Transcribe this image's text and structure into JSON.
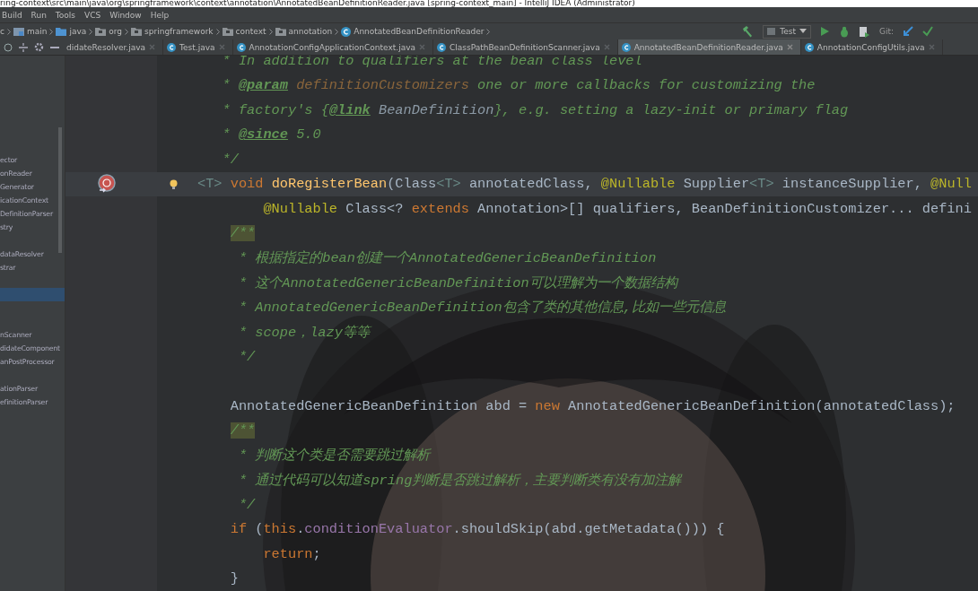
{
  "window": {
    "title": "ring-context\\src\\main\\java\\org\\springframework\\context\\annotation\\AnnotatedBeanDefinitionReader.java [spring-context_main] - IntelliJ IDEA (Administrator)"
  },
  "menu": [
    "Build",
    "Run",
    "Tools",
    "VCS",
    "Window",
    "Help"
  ],
  "breadcrumbs": [
    {
      "label": "c",
      "kind": "text"
    },
    {
      "label": "main",
      "kind": "module"
    },
    {
      "label": "java",
      "kind": "source"
    },
    {
      "label": "org",
      "kind": "folder"
    },
    {
      "label": "springframework",
      "kind": "folder"
    },
    {
      "label": "context",
      "kind": "folder"
    },
    {
      "label": "annotation",
      "kind": "folder"
    },
    {
      "label": "AnnotatedBeanDefinitionReader",
      "kind": "class"
    }
  ],
  "toolbar": {
    "run_config": "Test",
    "vcs_label": "Git:"
  },
  "tabs": [
    {
      "label": "didateResolver.java",
      "selected": false,
      "icon": false
    },
    {
      "label": "Test.java",
      "selected": false,
      "icon": true
    },
    {
      "label": "AnnotationConfigApplicationContext.java",
      "selected": false,
      "icon": true
    },
    {
      "label": "ClassPathBeanDefinitionScanner.java",
      "selected": false,
      "icon": true
    },
    {
      "label": "AnnotatedBeanDefinitionReader.java",
      "selected": true,
      "icon": true
    },
    {
      "label": "AnnotationConfigUtils.java",
      "selected": false,
      "icon": true
    }
  ],
  "sidebar": {
    "items": [
      {
        "kind": "gap"
      },
      {
        "kind": "gap"
      },
      {
        "kind": "gap"
      },
      {
        "kind": "gap"
      },
      {
        "kind": "gap"
      },
      {
        "kind": "gap"
      },
      {
        "kind": "gap"
      },
      {
        "kind": "item",
        "label": "ector",
        "selected": false
      },
      {
        "kind": "item",
        "label": "onReader",
        "selected": false
      },
      {
        "kind": "item",
        "label": "Generator",
        "selected": false
      },
      {
        "kind": "item",
        "label": "icationContext",
        "selected": false
      },
      {
        "kind": "item",
        "label": "DefinitionParser",
        "selected": false
      },
      {
        "kind": "item",
        "label": "stry",
        "selected": false
      },
      {
        "kind": "gap"
      },
      {
        "kind": "item",
        "label": "dataResolver",
        "selected": false
      },
      {
        "kind": "item",
        "label": "strar",
        "selected": false
      },
      {
        "kind": "gap"
      },
      {
        "kind": "item",
        "selected": true
      },
      {
        "kind": "gap"
      },
      {
        "kind": "gap"
      },
      {
        "kind": "item",
        "label": "nScanner",
        "selected": false
      },
      {
        "kind": "item",
        "label": "didateComponent",
        "selected": false
      },
      {
        "kind": "item",
        "label": "anPostProcessor",
        "selected": false
      },
      {
        "kind": "gap"
      },
      {
        "kind": "item",
        "label": "ationParser",
        "selected": false
      },
      {
        "kind": "item",
        "label": "efinitionParser",
        "selected": false
      }
    ]
  },
  "editor": {
    "lines": [
      {
        "kind": "doc",
        "tokens": [
          {
            "kind": "doc",
            "text": "* In addition to qualifiers at the bean class level"
          }
        ]
      },
      {
        "kind": "doc",
        "tokens": [
          {
            "kind": "doc",
            "text": "* "
          },
          {
            "kind": "doc-tag",
            "text": "@param"
          },
          {
            "kind": "doc-param",
            "text": " definitionCustomizers"
          },
          {
            "kind": "doc",
            "text": " one or more callbacks for customizing the"
          }
        ]
      },
      {
        "kind": "doc",
        "tokens": [
          {
            "kind": "doc",
            "text": "* factory's {"
          },
          {
            "kind": "doc-tag",
            "text": "@link"
          },
          {
            "kind": "doc-link",
            "text": " BeanDefinition"
          },
          {
            "kind": "doc",
            "text": "}, e.g. setting a lazy-init or primary flag"
          }
        ]
      },
      {
        "kind": "doc",
        "tokens": [
          {
            "kind": "doc",
            "text": "* "
          },
          {
            "kind": "doc-tag",
            "text": "@since"
          },
          {
            "kind": "doc",
            "text": " 5.0"
          }
        ]
      },
      {
        "kind": "doc",
        "tokens": [
          {
            "kind": "doc",
            "text": "*/"
          }
        ]
      },
      {
        "kind": "signature",
        "current": true,
        "marker": true,
        "bulb": true,
        "tokens": [
          {
            "kind": "type-param",
            "text": "<T>"
          },
          {
            "kind": "keyword",
            "text": " void "
          },
          {
            "kind": "method",
            "text": "doRegisterBean"
          },
          {
            "kind": "text",
            "text": "(Class"
          },
          {
            "kind": "type-param",
            "text": "<T>"
          },
          {
            "kind": "text",
            "text": " annotatedClass, "
          },
          {
            "kind": "annotation",
            "text": "@Nullable"
          },
          {
            "kind": "text",
            "text": " Supplier"
          },
          {
            "kind": "type-param",
            "text": "<T>"
          },
          {
            "kind": "text",
            "text": " instanceSupplier, "
          },
          {
            "kind": "annotation",
            "text": "@Null"
          }
        ]
      },
      {
        "kind": "continuation",
        "tokens": [
          {
            "kind": "annotation",
            "text": "@Nullable"
          },
          {
            "kind": "text",
            "text": " Class<? "
          },
          {
            "kind": "keyword",
            "text": "extends"
          },
          {
            "kind": "text",
            "text": " Annotation>[] qualifiers, BeanDefinitionCustomizer... defini"
          }
        ]
      },
      {
        "kind": "body",
        "tokens": [
          {
            "kind": "doc-fold",
            "text": "/**"
          }
        ]
      },
      {
        "kind": "body-doc",
        "tokens": [
          {
            "kind": "doc",
            "text": "* 根据指定的bean创建一个AnnotatedGenericBeanDefinition"
          }
        ]
      },
      {
        "kind": "body-doc",
        "tokens": [
          {
            "kind": "doc",
            "text": "* 这个AnnotatedGenericBeanDefinition可以理解为一个数据结构"
          }
        ]
      },
      {
        "kind": "body-doc",
        "tokens": [
          {
            "kind": "doc",
            "text": "* AnnotatedGenericBeanDefinition包含了类的其他信息,比如一些元信息"
          }
        ]
      },
      {
        "kind": "body-doc",
        "tokens": [
          {
            "kind": "doc",
            "text": "* scope，lazy等等"
          }
        ]
      },
      {
        "kind": "body-doc",
        "tokens": [
          {
            "kind": "doc",
            "text": "*/"
          }
        ]
      },
      {
        "kind": "blank"
      },
      {
        "kind": "body",
        "tokens": [
          {
            "kind": "text",
            "text": "AnnotatedGenericBeanDefinition abd = "
          },
          {
            "kind": "keyword",
            "text": "new"
          },
          {
            "kind": "text",
            "text": " AnnotatedGenericBeanDefinition(annotatedClass);"
          }
        ]
      },
      {
        "kind": "body",
        "tokens": [
          {
            "kind": "doc-fold",
            "text": "/**"
          }
        ]
      },
      {
        "kind": "body-doc",
        "tokens": [
          {
            "kind": "doc",
            "text": "* 判断这个类是否需要跳过解析"
          }
        ]
      },
      {
        "kind": "body-doc",
        "tokens": [
          {
            "kind": "doc",
            "text": "* 通过代码可以知道spring判断是否跳过解析，主要判断类有没有加注解"
          }
        ]
      },
      {
        "kind": "body-doc",
        "tokens": [
          {
            "kind": "doc",
            "text": "*/"
          }
        ]
      },
      {
        "kind": "body",
        "tokens": [
          {
            "kind": "keyword",
            "text": "if"
          },
          {
            "kind": "text",
            "text": " ("
          },
          {
            "kind": "keyword",
            "text": "this"
          },
          {
            "kind": "text",
            "text": "."
          },
          {
            "kind": "field",
            "text": "conditionEvaluator"
          },
          {
            "kind": "text",
            "text": ".shouldSkip(abd.getMetadata())) {"
          }
        ]
      },
      {
        "kind": "continuation",
        "tokens": [
          {
            "kind": "keyword",
            "text": "return"
          },
          {
            "kind": "text",
            "text": ";"
          }
        ]
      },
      {
        "kind": "body",
        "tokens": [
          {
            "kind": "text",
            "text": "}"
          }
        ]
      }
    ]
  }
}
